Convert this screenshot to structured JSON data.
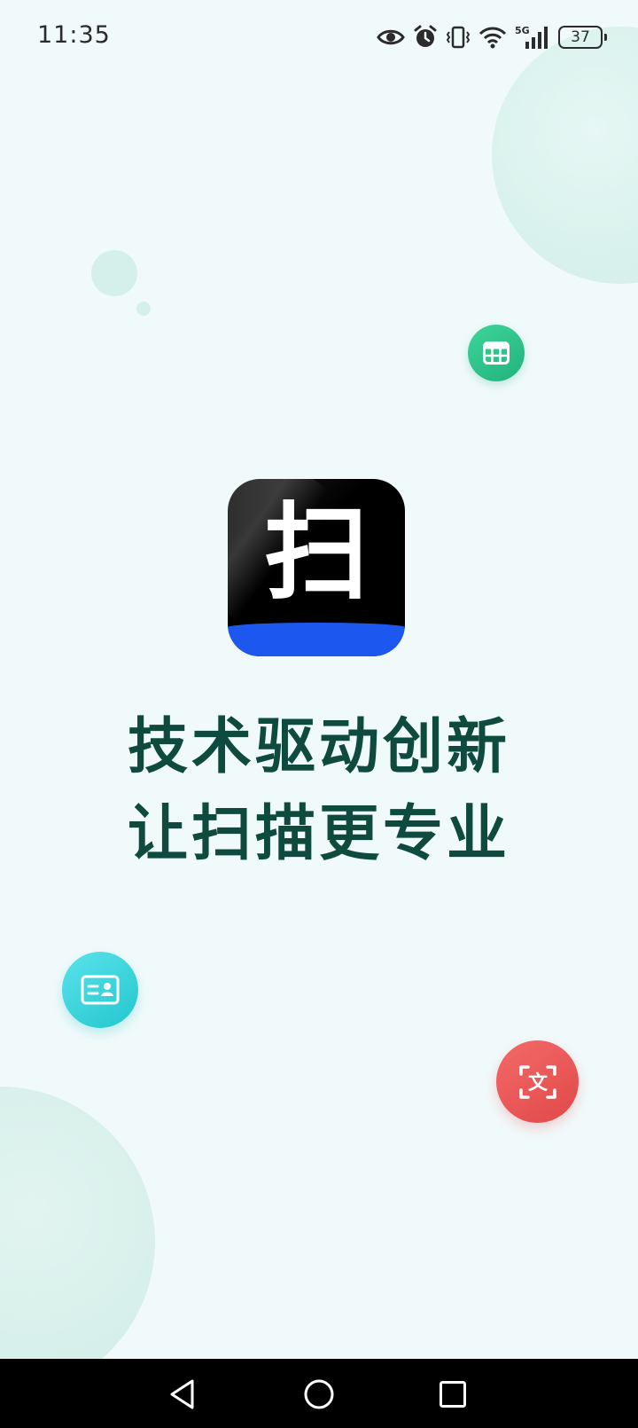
{
  "status_bar": {
    "time": "11:35",
    "network": "5G",
    "battery": "37",
    "icons": [
      "eye-icon",
      "alarm-icon",
      "vibrate-icon",
      "wifi-icon",
      "signal-icon",
      "battery-icon"
    ]
  },
  "logo": {
    "char": "扫",
    "colors": {
      "background": "#000000",
      "band": "#1c57f0"
    }
  },
  "slogan": {
    "line1": "技术驱动创新",
    "line2": "让扫描更专业",
    "color": "#0f4a3e"
  },
  "floating_icons": [
    {
      "name": "table-icon",
      "color": "#2cc489"
    },
    {
      "name": "id-card-icon",
      "color": "#3bd3dc"
    },
    {
      "name": "text-scan-icon",
      "color": "#ea5656",
      "glyph": "文"
    }
  ],
  "nav_bar": {
    "icons": [
      "back-icon",
      "home-icon",
      "recents-icon"
    ]
  }
}
